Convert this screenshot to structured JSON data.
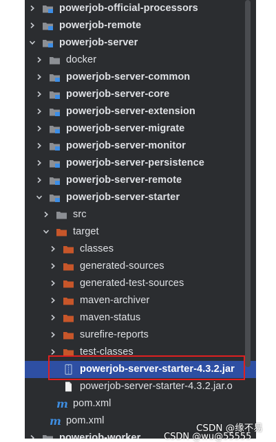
{
  "tree": [
    {
      "label": "powerjob-official-processors",
      "depth": 0,
      "chev": "right",
      "icon": "module",
      "bold": true
    },
    {
      "label": "powerjob-remote",
      "depth": 0,
      "chev": "right",
      "icon": "module",
      "bold": true
    },
    {
      "label": "powerjob-server",
      "depth": 0,
      "chev": "down",
      "icon": "module",
      "bold": true
    },
    {
      "label": "docker",
      "depth": 1,
      "chev": "right",
      "icon": "folder",
      "bold": false
    },
    {
      "label": "powerjob-server-common",
      "depth": 1,
      "chev": "right",
      "icon": "module",
      "bold": true
    },
    {
      "label": "powerjob-server-core",
      "depth": 1,
      "chev": "right",
      "icon": "module",
      "bold": true
    },
    {
      "label": "powerjob-server-extension",
      "depth": 1,
      "chev": "right",
      "icon": "module",
      "bold": true
    },
    {
      "label": "powerjob-server-migrate",
      "depth": 1,
      "chev": "right",
      "icon": "module",
      "bold": true
    },
    {
      "label": "powerjob-server-monitor",
      "depth": 1,
      "chev": "right",
      "icon": "module",
      "bold": true
    },
    {
      "label": "powerjob-server-persistence",
      "depth": 1,
      "chev": "right",
      "icon": "module",
      "bold": true
    },
    {
      "label": "powerjob-server-remote",
      "depth": 1,
      "chev": "right",
      "icon": "module",
      "bold": true
    },
    {
      "label": "powerjob-server-starter",
      "depth": 1,
      "chev": "down",
      "icon": "module",
      "bold": true
    },
    {
      "label": "src",
      "depth": 2,
      "chev": "right",
      "icon": "folder",
      "bold": false
    },
    {
      "label": "target",
      "depth": 2,
      "chev": "down",
      "icon": "folder-orange",
      "bold": false
    },
    {
      "label": "classes",
      "depth": 3,
      "chev": "right",
      "icon": "folder-orange",
      "bold": false
    },
    {
      "label": "generated-sources",
      "depth": 3,
      "chev": "right",
      "icon": "folder-orange",
      "bold": false
    },
    {
      "label": "generated-test-sources",
      "depth": 3,
      "chev": "right",
      "icon": "folder-orange",
      "bold": false
    },
    {
      "label": "maven-archiver",
      "depth": 3,
      "chev": "right",
      "icon": "folder-orange",
      "bold": false
    },
    {
      "label": "maven-status",
      "depth": 3,
      "chev": "right",
      "icon": "folder-orange",
      "bold": false
    },
    {
      "label": "surefire-reports",
      "depth": 3,
      "chev": "right",
      "icon": "folder-orange",
      "bold": false
    },
    {
      "label": "test-classes",
      "depth": 3,
      "chev": "right",
      "icon": "folder-orange",
      "bold": false
    },
    {
      "label": "powerjob-server-starter-4.3.2.jar",
      "depth": 3,
      "chev": "none",
      "icon": "jar",
      "bold": true,
      "selected": true
    },
    {
      "label": "powerjob-server-starter-4.3.2.jar.o",
      "depth": 3,
      "chev": "none",
      "icon": "file",
      "bold": false
    },
    {
      "label": "pom.xml",
      "depth": 2,
      "chev": "none",
      "icon": "maven",
      "bold": false
    },
    {
      "label": "pom.xml",
      "depth": 1,
      "chev": "none",
      "icon": "maven",
      "bold": false
    },
    {
      "label": "powerjob-worker",
      "depth": 0,
      "chev": "right",
      "icon": "module",
      "bold": true
    }
  ],
  "watermarks": {
    "primary": "CSDN @缘不易",
    "secondary": "CSDN @wu@55555"
  },
  "colors": {
    "panel_bg": "#2b2d30",
    "text": "#dfe1e5",
    "selection": "#2e4fa3",
    "folder_grey": "#8c8f94",
    "folder_orange": "#c7562a",
    "module_blue": "#3d8ee6",
    "highlight_box": "#e02020"
  }
}
